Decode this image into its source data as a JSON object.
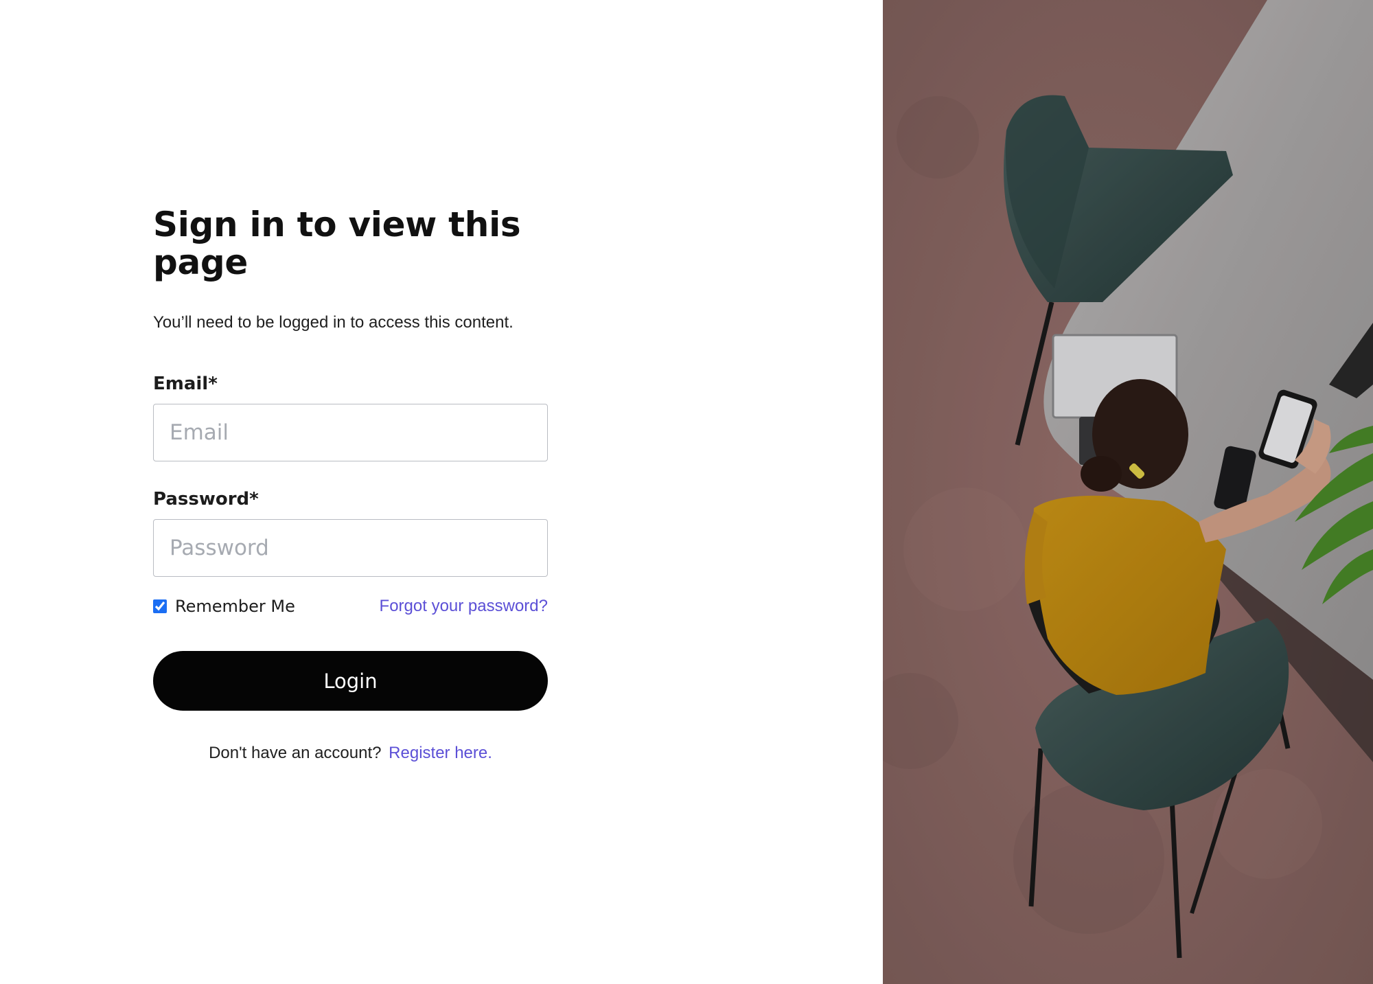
{
  "form": {
    "title": "Sign in to view this page",
    "subtitle": "You’ll need to be logged in to access this content.",
    "email": {
      "label": "Email*",
      "value": "",
      "placeholder": "Email"
    },
    "password": {
      "label": "Password*",
      "value": "",
      "placeholder": "Password"
    },
    "remember_me": {
      "label": "Remember Me",
      "checked": true
    },
    "forgot_password_link": "Forgot your password?",
    "login_button": "Login",
    "register_prompt": "Don't have an account?",
    "register_link": "Register here."
  },
  "colors": {
    "link": "#5b4fd6",
    "button_background": "#050505",
    "checkbox_accent": "#1b6ef3",
    "photo_overlay_tint": "#8f6965"
  },
  "photo": {
    "description_icon": "photo-illustration"
  }
}
